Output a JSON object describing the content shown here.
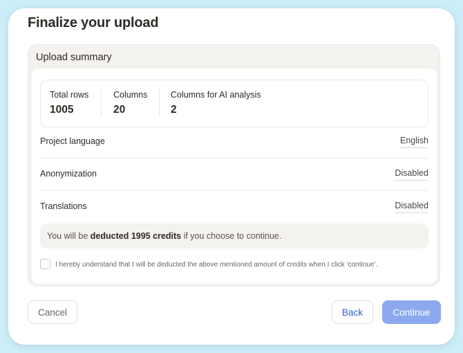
{
  "dialog": {
    "title": "Finalize your upload"
  },
  "summary": {
    "title": "Upload summary",
    "stats": [
      {
        "label": "Total rows",
        "value": "1005"
      },
      {
        "label": "Columns",
        "value": "20"
      },
      {
        "label": "Columns for AI analysis",
        "value": "2"
      }
    ],
    "rows": [
      {
        "label": "Project language",
        "value": "English"
      },
      {
        "label": "Anonymization",
        "value": "Disabled"
      },
      {
        "label": "Translations",
        "value": "Disabled"
      }
    ],
    "notice": {
      "prefix": "You will be ",
      "emphasis": "deducted 1995 credits",
      "suffix": " if you choose to continue."
    },
    "consent": {
      "checked": false,
      "label": "I hereby understand that I will be deducted the above mentioned amount of credits when I click ‘continue’."
    }
  },
  "footer": {
    "cancel_label": "Cancel",
    "back_label": "Back",
    "continue_label": "Continue"
  },
  "colors": {
    "background": "#cdeef9",
    "primary_disabled": "#8ca9ef",
    "link": "#2b5fd9"
  }
}
